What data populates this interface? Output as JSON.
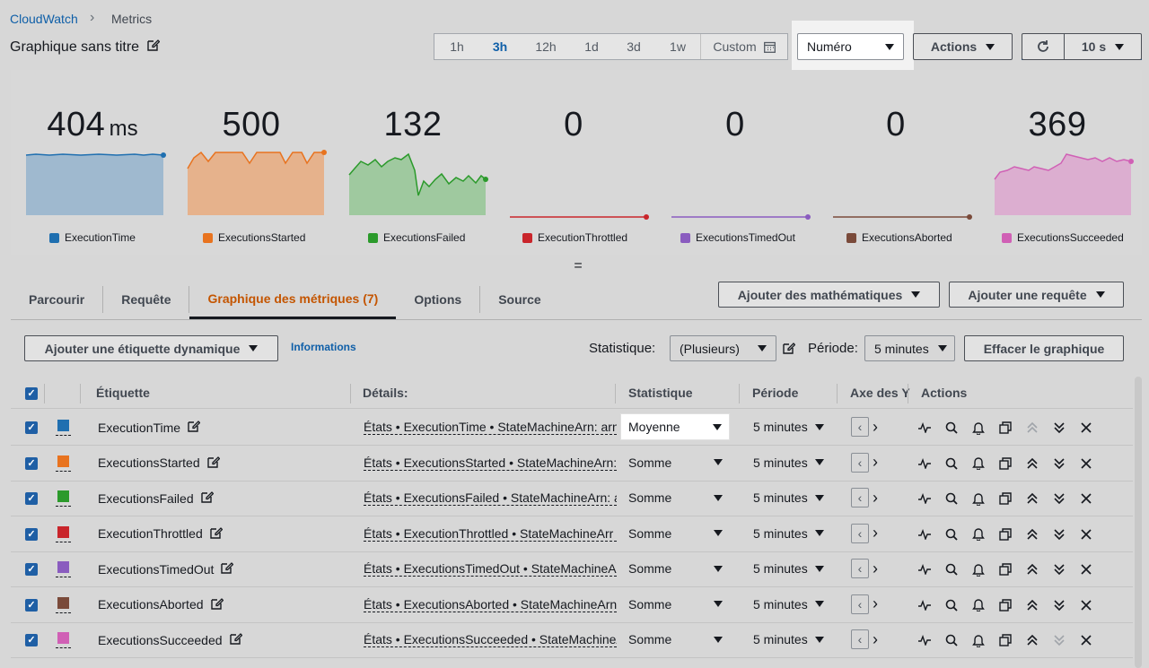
{
  "breadcrumb": {
    "root": "CloudWatch",
    "current": "Metrics"
  },
  "page": {
    "title": "Graphique sans titre"
  },
  "time_range": {
    "options": [
      "1h",
      "3h",
      "12h",
      "1d",
      "3d",
      "1w"
    ],
    "selected": "3h",
    "custom_label": "Custom"
  },
  "view_select": {
    "value": "Numéro"
  },
  "actions": {
    "label": "Actions"
  },
  "refresh": {
    "interval": "10 s"
  },
  "metrics": [
    {
      "value": "404",
      "unit": "ms",
      "label": "ExecutionTime",
      "color": "#1f6fb0"
    },
    {
      "value": "500",
      "unit": "",
      "label": "ExecutionsStarted",
      "color": "#e8731f"
    },
    {
      "value": "132",
      "unit": "",
      "label": "ExecutionsFailed",
      "color": "#2b9a2b"
    },
    {
      "value": "0",
      "unit": "",
      "label": "ExecutionThrottled",
      "color": "#c9252b"
    },
    {
      "value": "0",
      "unit": "",
      "label": "ExecutionsTimedOut",
      "color": "#8a5cbf"
    },
    {
      "value": "0",
      "unit": "",
      "label": "ExecutionsAborted",
      "color": "#7a4a3a"
    },
    {
      "value": "369",
      "unit": "",
      "label": "ExecutionsSucceeded",
      "color": "#d060b5"
    }
  ],
  "tabs": {
    "browse": "Parcourir",
    "query": "Requête",
    "graphed": "Graphique des métriques (7)",
    "options": "Options",
    "source": "Source"
  },
  "toolbar": {
    "add_math": "Ajouter des mathématiques",
    "add_query": "Ajouter une requête",
    "add_label": "Ajouter une étiquette dynamique",
    "info": "Informations",
    "stat_label": "Statistique:",
    "stat_value": "(Plusieurs)",
    "period_label": "Période:",
    "period_value": "5 minutes",
    "clear": "Effacer le graphique"
  },
  "table": {
    "headers": {
      "label": "Étiquette",
      "details": "Détails:",
      "stat": "Statistique",
      "period": "Période",
      "yaxis": "Axe des Y",
      "actions": "Actions"
    },
    "rows": [
      {
        "label": "ExecutionTime",
        "details": "États • ExecutionTime • StateMachineArn: arn",
        "stat": "Moyenne",
        "period": "5 minutes",
        "color": "#1f6fb0"
      },
      {
        "label": "ExecutionsStarted",
        "details": "États • ExecutionsStarted • StateMachineArn:",
        "stat": "Somme",
        "period": "5 minutes",
        "color": "#e8731f"
      },
      {
        "label": "ExecutionsFailed",
        "details": "États • ExecutionsFailed • StateMachineArn: a",
        "stat": "Somme",
        "period": "5 minutes",
        "color": "#2b9a2b"
      },
      {
        "label": "ExecutionThrottled",
        "details": "États • ExecutionThrottled • StateMachineArr",
        "stat": "Somme",
        "period": "5 minutes",
        "color": "#c9252b"
      },
      {
        "label": "ExecutionsTimedOut",
        "details": "États • ExecutionsTimedOut • StateMachineA",
        "stat": "Somme",
        "period": "5 minutes",
        "color": "#8a5cbf"
      },
      {
        "label": "ExecutionsAborted",
        "details": "États • ExecutionsAborted • StateMachineArn",
        "stat": "Somme",
        "period": "5 minutes",
        "color": "#7a4a3a"
      },
      {
        "label": "ExecutionsSucceeded",
        "details": "États • ExecutionsSucceeded • StateMachineA",
        "stat": "Somme",
        "period": "5 minutes",
        "color": "#d060b5"
      }
    ]
  }
}
